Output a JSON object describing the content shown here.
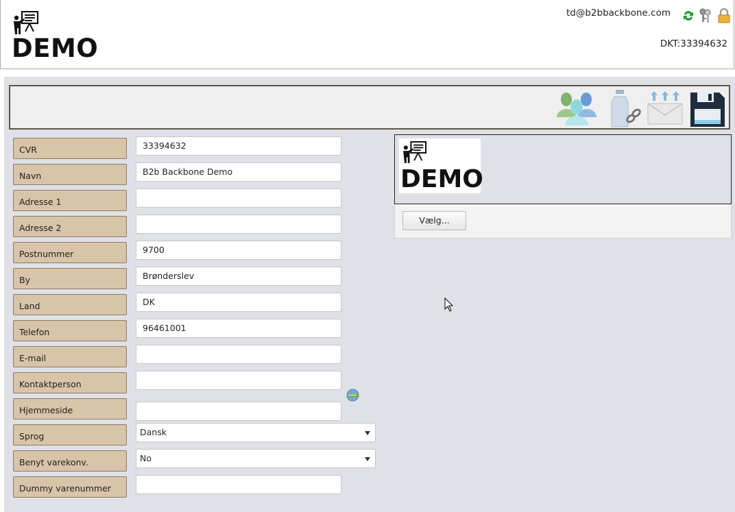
{
  "header": {
    "logo_text": "DEMO",
    "user_email": "td@b2bbackbone.com",
    "account_id": "DKT:33394632"
  },
  "toolbar": {
    "icons": [
      "users-icon",
      "bottle-link-icon",
      "mail-upload-icon",
      "save-disk-icon"
    ]
  },
  "form": {
    "fields": [
      {
        "label": "CVR",
        "value": "33394632"
      },
      {
        "label": "Navn",
        "value": "B2b Backbone Demo"
      },
      {
        "label": "Adresse 1",
        "value": ""
      },
      {
        "label": "Adresse 2",
        "value": ""
      },
      {
        "label": "Postnummer",
        "value": "9700"
      },
      {
        "label": "By",
        "value": "Brønderslev"
      },
      {
        "label": "Land",
        "value": "DK"
      },
      {
        "label": "Telefon",
        "value": "96461001"
      },
      {
        "label": "E-mail",
        "value": ""
      },
      {
        "label": "Kontaktperson",
        "value": ""
      },
      {
        "label": "Hjemmeside",
        "value": ""
      },
      {
        "label": "Sprog",
        "value": "Dansk"
      },
      {
        "label": "Benyt varekonv.",
        "value": "No"
      },
      {
        "label": "Dummy varenummer",
        "value": ""
      }
    ]
  },
  "image_panel": {
    "logo_text": "DEMO",
    "choose_button": "Vælg..."
  },
  "colors": {
    "label_bg": "#d8c4a8",
    "panel_bg": "#dfe1e7",
    "toolbar_border": "#5e5448"
  }
}
